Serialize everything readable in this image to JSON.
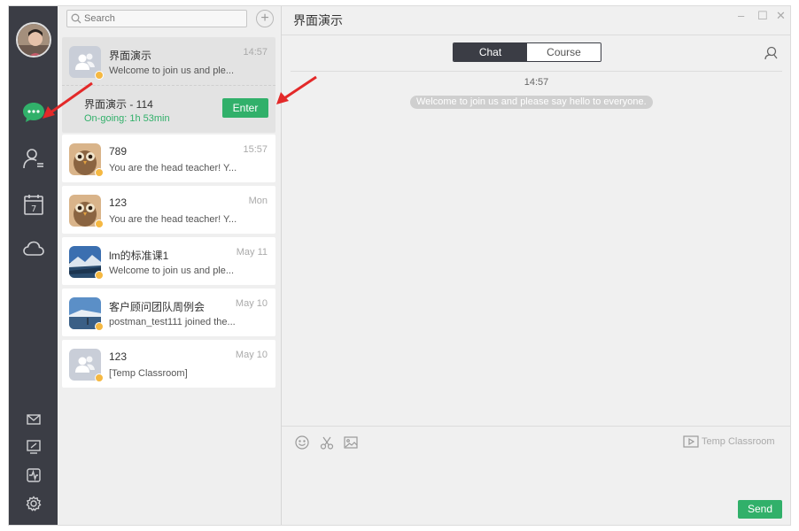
{
  "search": {
    "placeholder": "Search"
  },
  "add_button": {
    "label": "+"
  },
  "conversations": [
    {
      "name": "界面演示",
      "time": "14:57",
      "preview": "Welcome to join us and ple..."
    },
    {
      "name": "789",
      "time": "15:57",
      "preview": "You are the head teacher! Y..."
    },
    {
      "name": "123",
      "time": "Mon",
      "preview": "You are the head teacher! Y..."
    },
    {
      "name": "lm的标准课1",
      "time": "May 11",
      "preview": "Welcome to join us and ple..."
    },
    {
      "name": "客户顾问团队周例会",
      "time": "May 10",
      "preview": "postman_test111 joined the..."
    },
    {
      "name": "123",
      "time": "May 10",
      "preview": "[Temp Classroom]"
    }
  ],
  "live_session": {
    "name": "界面演示 - 114",
    "status": "On-going: 1h 53min",
    "enter_label": "Enter"
  },
  "chat": {
    "title": "界面演示",
    "tabs": [
      "Chat",
      "Course"
    ],
    "active_tab": "Chat",
    "message_time": "14:57",
    "system_message": "Welcome to join us and please say hello to everyone.",
    "temp_classroom_label": "Temp Classroom",
    "send_label": "Send"
  },
  "window_controls": {
    "minimize": "–",
    "maximize": "☐",
    "close": "✕"
  },
  "colors": {
    "sidebar": "#3b3d45",
    "accent_green": "#31b06a",
    "annotation_red": "#e32929",
    "badge": "#f5b842"
  },
  "icons": {
    "rail": [
      "chat-icon",
      "contacts-icon",
      "calendar-icon",
      "cloud-icon",
      "mail-icon",
      "whiteboard-icon",
      "activity-icon",
      "settings-icon"
    ],
    "input_toolbar": [
      "emoji-icon",
      "scissors-icon",
      "image-icon"
    ]
  }
}
